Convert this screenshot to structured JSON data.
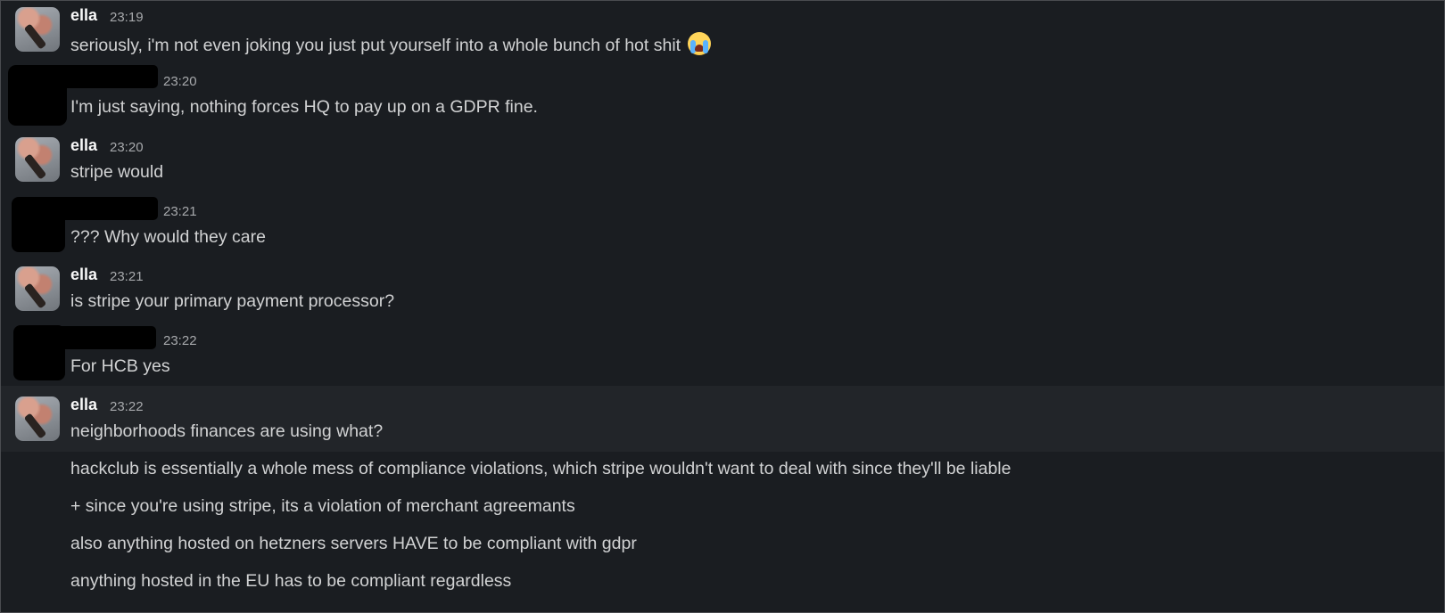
{
  "messages": [
    {
      "author": "ella",
      "time": "23:19",
      "lines": [
        "seriously, i'm not even joking you just put yourself into a whole bunch of hot shit"
      ],
      "emoji": "loudly-crying-face"
    },
    {
      "author": "",
      "time": "23:20",
      "lines": [
        "I'm just saying, nothing forces HQ to pay up on a GDPR fine."
      ]
    },
    {
      "author": "ella",
      "time": "23:20",
      "lines": [
        "stripe would"
      ]
    },
    {
      "author": "",
      "time": "23:21",
      "lines": [
        "??? Why would they care"
      ]
    },
    {
      "author": "ella",
      "time": "23:21",
      "lines": [
        "is stripe your primary payment processor?"
      ]
    },
    {
      "author": "",
      "time": "23:22",
      "lines": [
        "For HCB yes"
      ]
    },
    {
      "author": "ella",
      "time": "23:22",
      "lines": [
        "neighborhoods finances are using what?",
        "hackclub is essentially a whole mess of compliance violations, which stripe wouldn't want to deal with since they'll be liable",
        "+ since you're using stripe, its a violation of merchant agreemants",
        "also anything hosted on hetzners servers HAVE to be compliant with gdpr",
        "anything hosted in the EU has to be compliant regardless"
      ]
    }
  ],
  "colors": {
    "background": "#1a1d21",
    "hover_row": "#222529",
    "text": "#d1d2d3",
    "name": "#f8f8f8",
    "timestamp": "#a7a9ac"
  }
}
